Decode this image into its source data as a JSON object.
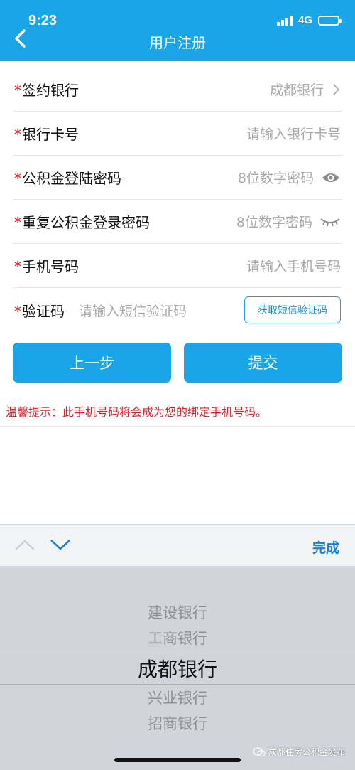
{
  "status_bar": {
    "time": "9:23",
    "network": "4G"
  },
  "header": {
    "title": "用户注册"
  },
  "form": {
    "required_mark": "*",
    "bank": {
      "label": "签约银行",
      "value": "成都银行"
    },
    "card": {
      "label": "银行卡号",
      "placeholder": "请输入银行卡号"
    },
    "password": {
      "label": "公积金登陆密码",
      "placeholder": "8位数字密码"
    },
    "password_repeat": {
      "label": "重复公积金登录密码",
      "placeholder": "8位数字密码"
    },
    "phone": {
      "label": "手机号码",
      "placeholder": "请输入手机号码"
    },
    "sms": {
      "label": "验证码",
      "placeholder": "请输入短信验证码",
      "button": "获取短信验证码"
    }
  },
  "actions": {
    "prev": "上一步",
    "submit": "提交"
  },
  "tip": "温馨提示：此手机号码将会成为您的绑定手机号码。",
  "toolbar": {
    "done": "完成"
  },
  "picker": {
    "options": [
      "建设银行",
      "工商银行",
      "成都银行",
      "兴业银行",
      "招商银行"
    ],
    "selected": "成都银行"
  },
  "watermark": "成都住房公积金发布",
  "colors": {
    "primary": "#1aa5e8",
    "required": "#d8212a",
    "placeholder": "#a8a8a8"
  }
}
